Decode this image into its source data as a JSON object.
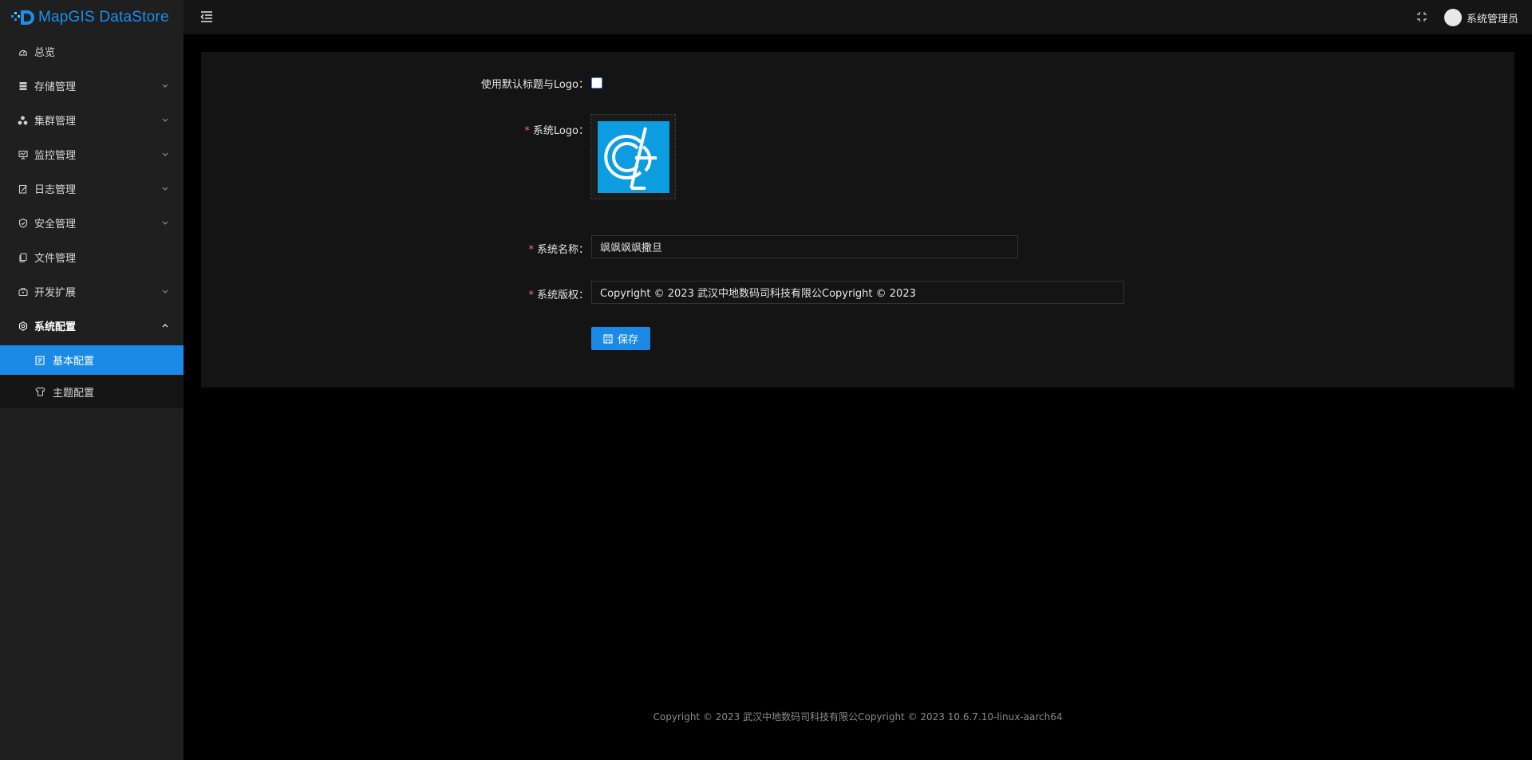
{
  "app": {
    "brand": "MapGIS DataStore"
  },
  "header": {
    "user_name": "系统管理员"
  },
  "sidebar": {
    "items": [
      {
        "label": "总览",
        "icon": "dashboard-icon",
        "has_children": false
      },
      {
        "label": "存储管理",
        "icon": "database-icon",
        "has_children": true
      },
      {
        "label": "集群管理",
        "icon": "cluster-icon",
        "has_children": true
      },
      {
        "label": "监控管理",
        "icon": "monitor-icon",
        "has_children": true
      },
      {
        "label": "日志管理",
        "icon": "log-icon",
        "has_children": true
      },
      {
        "label": "安全管理",
        "icon": "shield-icon",
        "has_children": true
      },
      {
        "label": "文件管理",
        "icon": "file-icon",
        "has_children": false
      },
      {
        "label": "开发扩展",
        "icon": "briefcase-icon",
        "has_children": true
      },
      {
        "label": "系统配置",
        "icon": "gear-icon",
        "has_children": true,
        "open": true
      }
    ],
    "subitems": [
      {
        "label": "基本配置",
        "icon": "config-icon",
        "active": true
      },
      {
        "label": "主题配置",
        "icon": "shirt-icon",
        "active": false
      }
    ]
  },
  "form": {
    "use_default_label": "使用默认标题与Logo：",
    "use_default_checked": false,
    "logo_label": "系统Logo：",
    "name_label": "系统名称：",
    "name_value": "飒飒飒飒撒旦",
    "copyright_label": "系统版权：",
    "copyright_value": "Copyright © 2023 武汉中地数码司科技有限公Copyright © 2023",
    "save_label": "保存",
    "required_mark": "*"
  },
  "footer": {
    "text": "Copyright © 2023 武汉中地数码司科技有限公Copyright © 2023 10.6.7.10-linux-aarch64"
  },
  "colors": {
    "accent": "#1a8ae6",
    "brand_blue": "#1a8ff0",
    "logo_bg": "#0b9de0",
    "required": "#f56c6c"
  }
}
